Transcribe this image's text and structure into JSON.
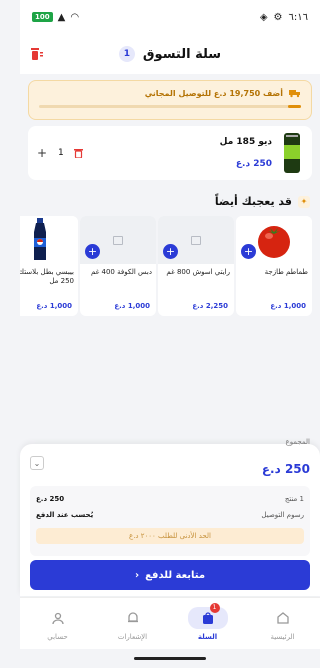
{
  "status_bar": {
    "time": "٦:١٦",
    "battery": "100"
  },
  "header": {
    "title": "سلة التسوق",
    "count": "1"
  },
  "promo": {
    "text": "أضف 19,750 د.ع للتوصيل المجاني",
    "progress": 0.05
  },
  "cart_items": [
    {
      "name": "ديو 185 مل",
      "price": "250 د.ع",
      "quantity": "1"
    }
  ],
  "recommendations": {
    "title": "قد يعجبك أيضاً",
    "items": [
      {
        "name": "طماطم طازجة",
        "price": "1,000 د.ع"
      },
      {
        "name": "رايتي اسوش 800 غم",
        "price": "2,250 د.ع"
      },
      {
        "name": "دبس الكوفة 400 غم",
        "price": "1,000 د.ع"
      },
      {
        "name": "بيبسي بطل بلاستك 250 مل",
        "price": "1,000 د.ع"
      }
    ]
  },
  "summary": {
    "total_label": "المجموع",
    "total_value": "250 د.ع",
    "items_label": "1 منتج",
    "items_value": "250 د.ع",
    "delivery_label": "رسوم التوصيل",
    "delivery_value": "يُحسب عند الدفع",
    "min_order": "الحد الأدنى للطلب ٢٠٠٠ د.ع"
  },
  "checkout": {
    "label": "متابعة للدفع"
  },
  "nav": {
    "home": "الرئيسية",
    "cart": "السلة",
    "cart_badge": "1",
    "notifications": "الإشعارات",
    "account": "حسابي"
  },
  "colors": {
    "primary": "#2b3bd6",
    "promo_bg": "#fdf1dc",
    "promo_text": "#b47305"
  }
}
